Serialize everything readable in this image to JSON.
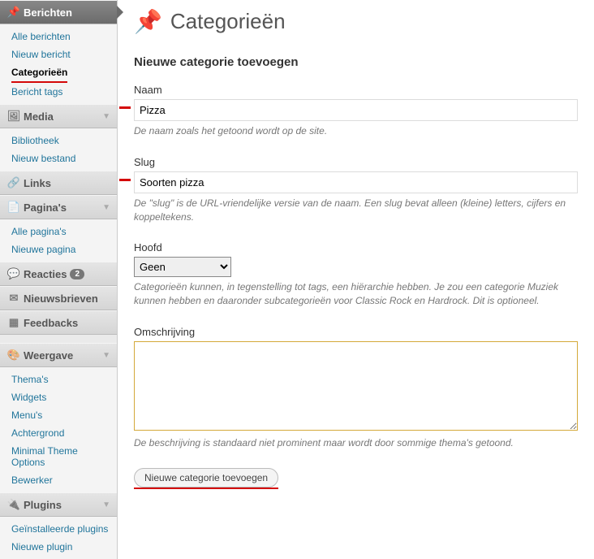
{
  "sidebar": {
    "berichten": {
      "label": "Berichten",
      "items": [
        "Alle berichten",
        "Nieuw bericht",
        "Categorieën",
        "Bericht tags"
      ],
      "current_index": 2
    },
    "media": {
      "label": "Media",
      "items": [
        "Bibliotheek",
        "Nieuw bestand"
      ]
    },
    "links": {
      "label": "Links"
    },
    "paginas": {
      "label": "Pagina's",
      "items": [
        "Alle pagina's",
        "Nieuwe pagina"
      ]
    },
    "reacties": {
      "label": "Reacties",
      "badge": "2"
    },
    "nieuwsbrieven": {
      "label": "Nieuwsbrieven"
    },
    "feedbacks": {
      "label": "Feedbacks"
    },
    "weergave": {
      "label": "Weergave",
      "items": [
        "Thema's",
        "Widgets",
        "Menu's",
        "Achtergrond",
        "Minimal Theme Options",
        "Bewerker"
      ]
    },
    "plugins": {
      "label": "Plugins",
      "items": [
        "Geïnstalleerde plugins",
        "Nieuwe plugin"
      ]
    }
  },
  "page": {
    "title": "Categorieën",
    "section_heading": "Nieuwe categorie toevoegen",
    "name_label": "Naam",
    "name_value": "Pizza",
    "name_desc": "De naam zoals het getoond wordt op de site.",
    "slug_label": "Slug",
    "slug_value": "Soorten pizza",
    "slug_desc": "De \"slug\" is de URL-vriendelijke versie van de naam. Een slug bevat alleen (kleine) letters, cijfers en koppeltekens.",
    "parent_label": "Hoofd",
    "parent_value": "Geen",
    "parent_desc": "Categorieën kunnen, in tegenstelling tot tags, een hiërarchie hebben. Je zou een categorie Muziek kunnen hebben en daaronder subcategorieën voor Classic Rock en Hardrock. Dit is optioneel.",
    "desc_label": "Omschrijving",
    "desc_desc": "De beschrijving is standaard niet prominent maar wordt door sommige thema's getoond.",
    "submit_label": "Nieuwe categorie toevoegen"
  }
}
